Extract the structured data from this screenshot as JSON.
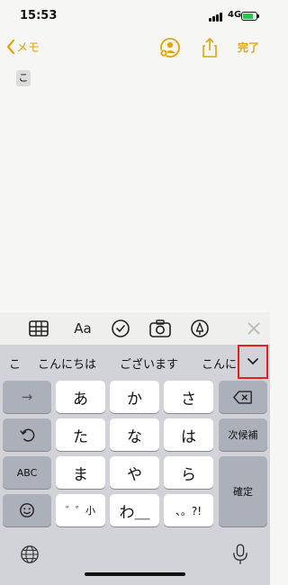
{
  "status": {
    "time": "15:53",
    "network": "4G",
    "battery_level": 0.75
  },
  "nav": {
    "back_label": "メモ",
    "done_label": "完了"
  },
  "note": {
    "text": "こ"
  },
  "format_bar": {
    "text_format_label": "Aa"
  },
  "keyboard": {
    "candidates": [
      "こ",
      "こんにちは",
      "ございます",
      "こんに"
    ],
    "keys": {
      "row1": [
        "あ",
        "か",
        "さ"
      ],
      "row2": [
        "た",
        "な",
        "は"
      ],
      "row3": [
        "ま",
        "や",
        "ら"
      ],
      "row4": [
        "゛゜小",
        "わ＿",
        "、。?!"
      ]
    },
    "left_fn": [
      "→",
      "ABC"
    ],
    "right_fn": {
      "next_candidate": "次候補",
      "confirm": "確定"
    }
  },
  "colors": {
    "accent": "#e0a50a",
    "highlight_border": "#e2211c"
  }
}
